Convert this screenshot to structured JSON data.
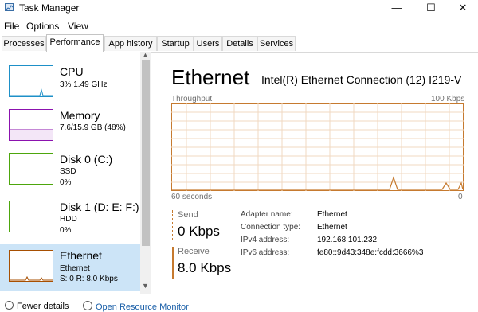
{
  "window": {
    "title": "Task Manager",
    "minimize_glyph": "—",
    "maximize_glyph": "☐",
    "close_glyph": "✕"
  },
  "menu": {
    "items": [
      {
        "label": "File"
      },
      {
        "label": "Options"
      },
      {
        "label": "View"
      }
    ]
  },
  "tabs": [
    {
      "label": "Processes"
    },
    {
      "label": "Performance",
      "active": true
    },
    {
      "label": "App history"
    },
    {
      "label": "Startup"
    },
    {
      "label": "Users"
    },
    {
      "label": "Details"
    },
    {
      "label": "Services"
    }
  ],
  "sidebar": {
    "items": [
      {
        "title": "CPU",
        "line1": "3% 1.49 GHz",
        "line2": "",
        "color": "#1e90c8"
      },
      {
        "title": "Memory",
        "line1": "7.6/15.9 GB (48%)",
        "line2": "",
        "color": "#8b12ae"
      },
      {
        "title": "Disk 0 (C:)",
        "line1": "SSD",
        "line2": "0%",
        "color": "#4da60c"
      },
      {
        "title": "Disk 1 (D: E: F:)",
        "line1": "HDD",
        "line2": "0%",
        "color": "#4da60c"
      },
      {
        "title": "Ethernet",
        "line1": "Ethernet",
        "line2": "S: 0 R: 8.0 Kbps",
        "color": "#a74f01",
        "selected": true
      }
    ]
  },
  "main": {
    "title": "Ethernet",
    "adapter": "Intel(R) Ethernet Connection (12) I219-V",
    "graph_label": "Throughput",
    "graph_max": "100 Kbps",
    "graph_time": "60 seconds",
    "graph_min": "0",
    "accent_color": "#a74f01",
    "send_label": "Send",
    "send_value": "0 Kbps",
    "receive_label": "Receive",
    "receive_value": "8.0 Kbps",
    "properties": [
      {
        "label": "Adapter name:",
        "value": "Ethernet"
      },
      {
        "label": "Connection type:",
        "value": "Ethernet"
      },
      {
        "label": "IPv4 address:",
        "value": "192.168.101.232"
      },
      {
        "label": "IPv6 address:",
        "value": "fe80::9d43:348e:fcdd:3666%3"
      }
    ]
  },
  "bottom": {
    "fewer_details": "Fewer details",
    "open_monitor": "Open Resource Monitor"
  }
}
